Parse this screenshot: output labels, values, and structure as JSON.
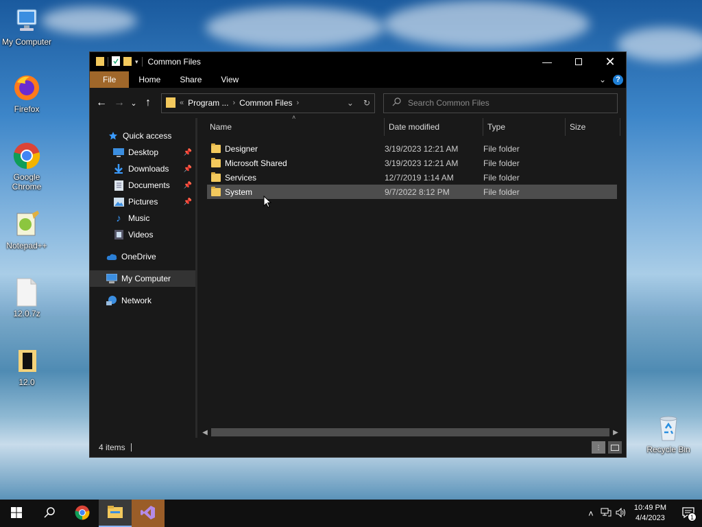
{
  "desktop": {
    "icons": [
      {
        "label": "My Computer",
        "icon": "computer-icon"
      },
      {
        "label": "Firefox",
        "icon": "firefox-icon"
      },
      {
        "label": "Google Chrome",
        "icon": "chrome-icon"
      },
      {
        "label": "Notepad++",
        "icon": "notepadpp-icon"
      },
      {
        "label": "12.0.7z",
        "icon": "file-icon"
      },
      {
        "label": "12.0",
        "icon": "folder-icon"
      },
      {
        "label": "Recycle Bin",
        "icon": "recycle-bin-icon"
      }
    ]
  },
  "window": {
    "title": "Common Files",
    "ribbon_tabs": [
      "File",
      "Home",
      "Share",
      "View"
    ],
    "help_label": "?",
    "address": {
      "overflow": "«",
      "segments": [
        "Program ...",
        "Common Files"
      ]
    },
    "search": {
      "placeholder": "Search Common Files"
    },
    "sidebar": [
      {
        "label": "Quick access",
        "icon": "star-icon",
        "pinned": false
      },
      {
        "label": "Desktop",
        "icon": "desktop-icon",
        "pinned": true
      },
      {
        "label": "Downloads",
        "icon": "download-icon",
        "pinned": true
      },
      {
        "label": "Documents",
        "icon": "documents-icon",
        "pinned": true
      },
      {
        "label": "Pictures",
        "icon": "pictures-icon",
        "pinned": true
      },
      {
        "label": "Music",
        "icon": "music-icon",
        "pinned": false
      },
      {
        "label": "Videos",
        "icon": "videos-icon",
        "pinned": false
      },
      {
        "label": "OneDrive",
        "icon": "cloud-icon",
        "pinned": false
      },
      {
        "label": "My Computer",
        "icon": "computer-icon",
        "pinned": false
      },
      {
        "label": "Network",
        "icon": "network-icon",
        "pinned": false
      }
    ],
    "columns": [
      "Name",
      "Date modified",
      "Type",
      "Size"
    ],
    "files": [
      {
        "name": "Designer",
        "date": "3/19/2023 12:21 AM",
        "type": "File folder"
      },
      {
        "name": "Microsoft Shared",
        "date": "3/19/2023 12:21 AM",
        "type": "File folder"
      },
      {
        "name": "Services",
        "date": "12/7/2019 1:14 AM",
        "type": "File folder"
      },
      {
        "name": "System",
        "date": "9/7/2022 8:12 PM",
        "type": "File folder"
      }
    ],
    "status": "4 items"
  },
  "taskbar": {
    "time": "10:49 PM",
    "date": "4/4/2023",
    "notification_count": "1"
  },
  "colors": {
    "accent_file_tab": "#a0672a",
    "folder": "#f3c95d",
    "window_bg": "#191919"
  }
}
